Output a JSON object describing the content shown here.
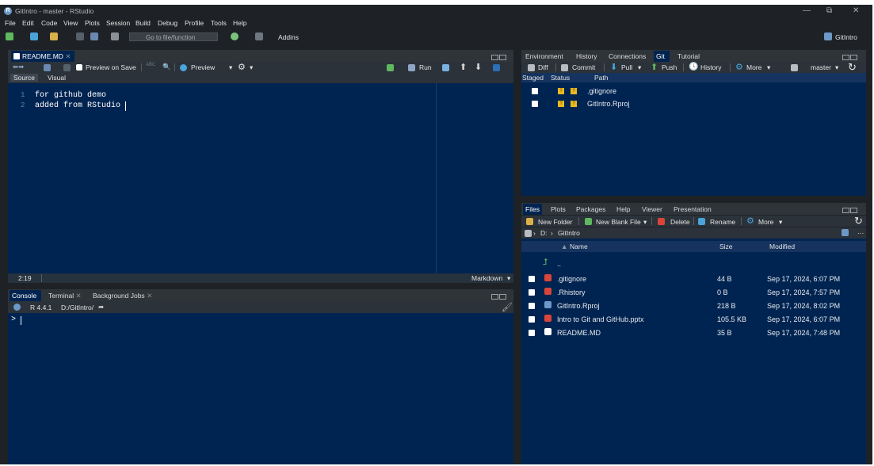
{
  "window": {
    "title": "GitIntro - master - RStudio",
    "controls": [
      "—",
      "⧉",
      "✕"
    ]
  },
  "menu": [
    "File",
    "Edit",
    "Code",
    "View",
    "Plots",
    "Session",
    "Build",
    "Debug",
    "Profile",
    "Tools",
    "Help"
  ],
  "toolbar": {
    "goto_placeholder": "Go to file/function",
    "addins": "Addins",
    "project": "GitIntro"
  },
  "editor": {
    "tab": "README.MD",
    "preview_on_save": "Preview on Save",
    "preview": "Preview",
    "run": "Run",
    "modes": {
      "source": "Source",
      "visual": "Visual"
    },
    "lines": [
      "for github demo",
      "added from RStudio"
    ],
    "line_numbers": [
      "1",
      "2"
    ],
    "cursor_pos": "2:19",
    "file_type": "Markdown"
  },
  "console": {
    "tabs": [
      "Console",
      "Terminal",
      "Background Jobs"
    ],
    "version": "R 4.4.1",
    "path": "D:/GitIntro/",
    "prompt": ">"
  },
  "git_pane": {
    "tabs": [
      "Environment",
      "History",
      "Connections",
      "Git",
      "Tutorial"
    ],
    "active_tab": "Git",
    "toolbar": {
      "diff": "Diff",
      "commit": "Commit",
      "pull": "Pull",
      "push": "Push",
      "history": "History",
      "more": "More",
      "branch": "master"
    },
    "columns": {
      "staged": "Staged",
      "status": "Status",
      "path": "Path"
    },
    "rows": [
      {
        "path": ".gitignore",
        "status": "??"
      },
      {
        "path": "GitIntro.Rproj",
        "status": "??"
      }
    ]
  },
  "files_pane": {
    "tabs": [
      "Files",
      "Plots",
      "Packages",
      "Help",
      "Viewer",
      "Presentation"
    ],
    "active_tab": "Files",
    "toolbar": {
      "new_folder": "New Folder",
      "new_blank_file": "New Blank File",
      "delete": "Delete",
      "rename": "Rename",
      "more": "More"
    },
    "breadcrumb": {
      "drive": "D:",
      "folder": "GitIntro"
    },
    "columns": {
      "name": "Name",
      "size": "Size",
      "modified": "Modified"
    },
    "parent": "..",
    "rows": [
      {
        "name": ".gitignore",
        "size": "44 B",
        "modified": "Sep 17, 2024, 6:07 PM",
        "icon": "red"
      },
      {
        "name": ".Rhistory",
        "size": "0 B",
        "modified": "Sep 17, 2024, 7:57 PM",
        "icon": "red"
      },
      {
        "name": "GitIntro.Rproj",
        "size": "218 B",
        "modified": "Sep 17, 2024, 8:02 PM",
        "icon": "blue"
      },
      {
        "name": "Intro to Git and GitHub.pptx",
        "size": "105.5 KB",
        "modified": "Sep 17, 2024, 6:07 PM",
        "icon": "red"
      },
      {
        "name": "README.MD",
        "size": "35 B",
        "modified": "Sep 17, 2024, 7:48 PM",
        "icon": "md"
      }
    ]
  }
}
